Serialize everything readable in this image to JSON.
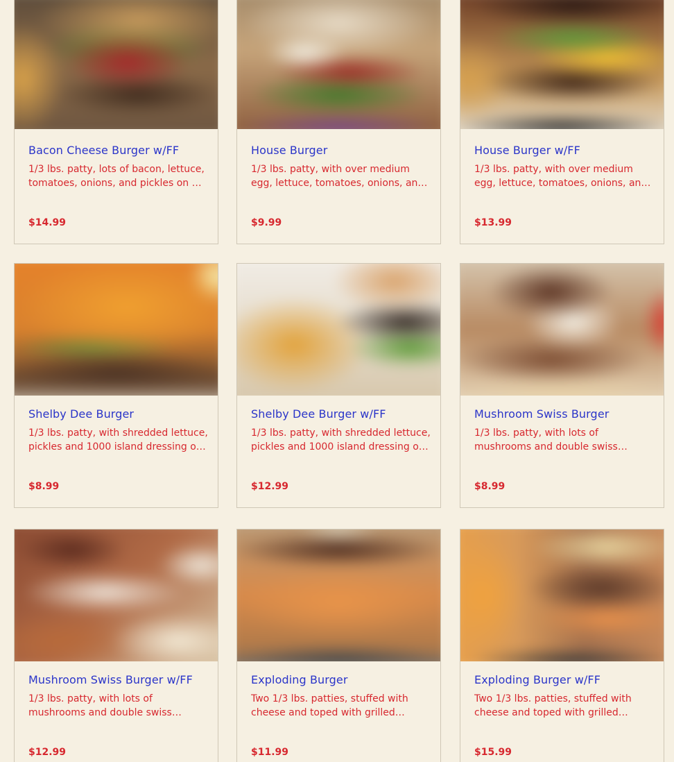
{
  "menu_items": [
    {
      "name": "Bacon Cheese Burger w/FF",
      "description": "1/3 lbs. patty, lots of bacon, lettuce, tomatoes, onions, and pickles on …",
      "price": "$14.99"
    },
    {
      "name": "House Burger",
      "description": "1/3 lbs. patty, with over medium egg, lettuce, tomatoes, onions, an…",
      "price": "$9.99"
    },
    {
      "name": "House Burger w/FF",
      "description": "1/3 lbs. patty, with over medium egg, lettuce, tomatoes, onions, an…",
      "price": "$13.99"
    },
    {
      "name": "Shelby Dee Burger",
      "description": "1/3 lbs. patty, with shredded lettuce, pickles and 1000 island dressing o…",
      "price": "$8.99"
    },
    {
      "name": "Shelby Dee Burger w/FF",
      "description": "1/3 lbs. patty, with shredded lettuce, pickles and 1000 island dressing o…",
      "price": "$12.99"
    },
    {
      "name": "Mushroom Swiss Burger",
      "description": "1/3 lbs. patty, with lots of mushrooms and double swiss…",
      "price": "$8.99"
    },
    {
      "name": "Mushroom Swiss Burger w/FF",
      "description": "1/3 lbs. patty, with lots of mushrooms and double swiss…",
      "price": "$12.99"
    },
    {
      "name": "Exploding Burger",
      "description": "Two 1/3 lbs. patties, stuffed with cheese and toped with grilled…",
      "price": "$11.99"
    },
    {
      "name": "Exploding Burger w/FF",
      "description": "Two 1/3 lbs. patties, stuffed with cheese and toped with grilled…",
      "price": "$15.99"
    }
  ],
  "colors": {
    "background": "#f6f0e2",
    "card_border": "#cfc7b6",
    "item_name": "#2b35c9",
    "item_text": "#d7282f"
  }
}
